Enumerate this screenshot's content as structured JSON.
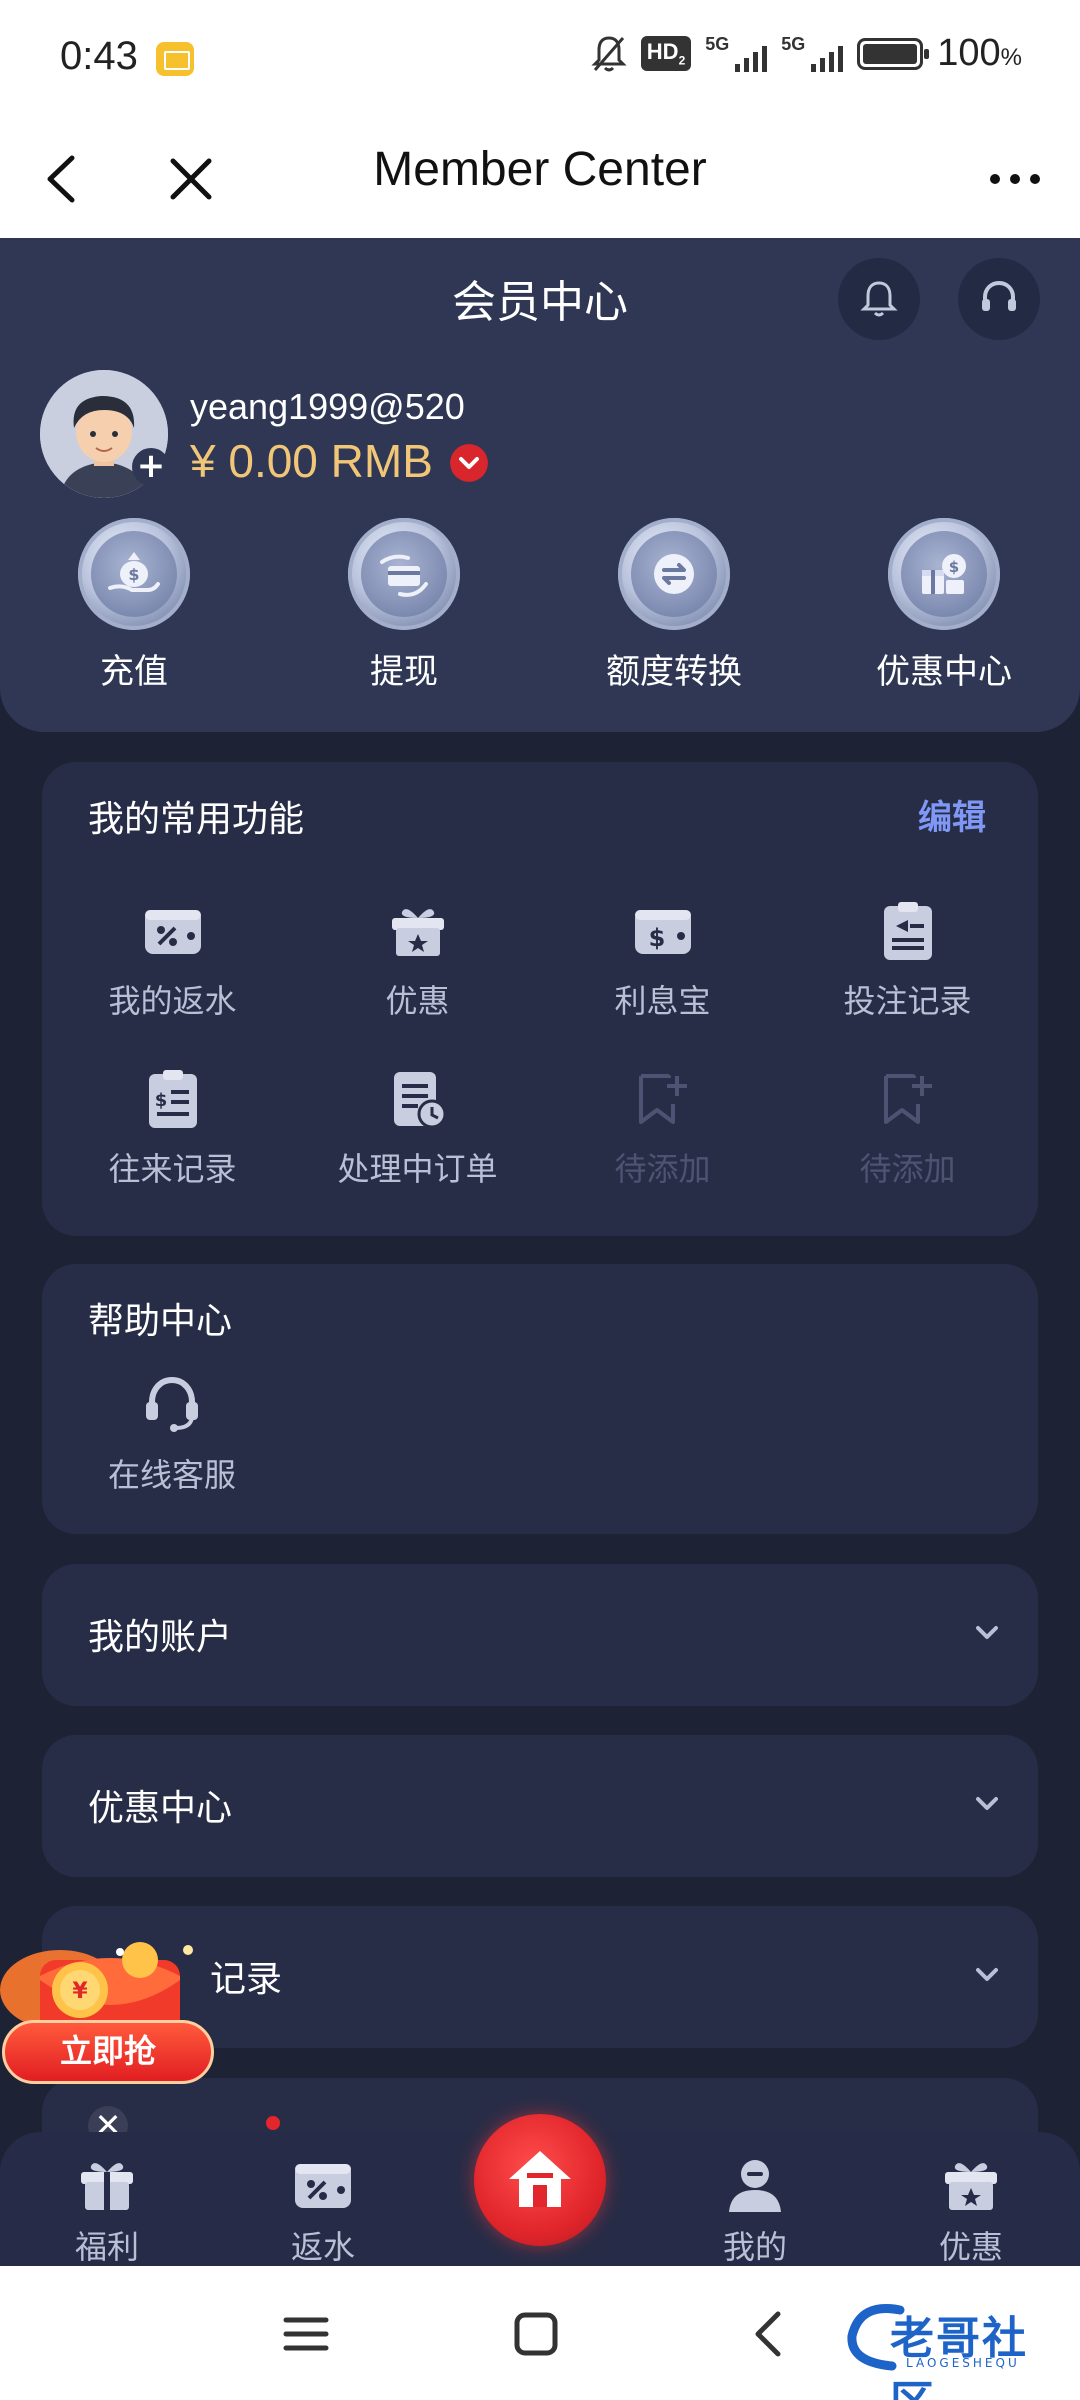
{
  "status_bar": {
    "time": "0:43",
    "hd": "HD",
    "hd_sub": "2",
    "net1": "5G",
    "net2": "5G",
    "battery": "100",
    "battery_unit": "%"
  },
  "header": {
    "title": "Member Center"
  },
  "hero": {
    "title": "会员中心",
    "username": "yeang1999@520",
    "balance": "¥ 0.00 RMB",
    "actions": [
      {
        "label": "充值",
        "icon": "money-bag-hand-icon"
      },
      {
        "label": "提现",
        "icon": "card-hand-icon"
      },
      {
        "label": "额度转换",
        "icon": "transfer-icon"
      },
      {
        "label": "优惠中心",
        "icon": "promo-gift-icon"
      }
    ]
  },
  "common_functions": {
    "title": "我的常用功能",
    "edit_label": "编辑",
    "items": [
      {
        "label": "我的返水",
        "icon": "percent-wallet-icon"
      },
      {
        "label": "优惠",
        "icon": "gift-icon"
      },
      {
        "label": "利息宝",
        "icon": "dollar-wallet-icon"
      },
      {
        "label": "投注记录",
        "icon": "clipboard-icon"
      },
      {
        "label": "往来记录",
        "icon": "transaction-list-icon"
      },
      {
        "label": "处理中订单",
        "icon": "pending-order-icon"
      },
      {
        "label": "待添加",
        "icon": "add-bookmark-icon"
      },
      {
        "label": "待添加",
        "icon": "add-bookmark-icon"
      }
    ]
  },
  "help_center": {
    "title": "帮助中心",
    "items": [
      {
        "label": "在线客服",
        "icon": "headset-icon"
      }
    ]
  },
  "accordions": [
    {
      "label": "我的账户"
    },
    {
      "label": "优惠中心"
    },
    {
      "label": "记录"
    }
  ],
  "promo": {
    "button": "立即抢",
    "close": "✕"
  },
  "bottom_nav": [
    {
      "label": "福利",
      "icon": "gift-icon"
    },
    {
      "label": "返水",
      "icon": "percent-wallet-icon"
    },
    {
      "label": "",
      "icon": "home-icon"
    },
    {
      "label": "我的",
      "icon": "user-icon"
    },
    {
      "label": "优惠",
      "icon": "gift-star-icon"
    }
  ],
  "watermark": {
    "text": "老哥社区",
    "sub": "LAOGESHEQU"
  },
  "colors": {
    "bg": "#1e2235",
    "hero": "#2f3755",
    "card": "#282d47",
    "gold": "#f1c777",
    "accent": "#7f98f5",
    "red": "#e2262b"
  }
}
